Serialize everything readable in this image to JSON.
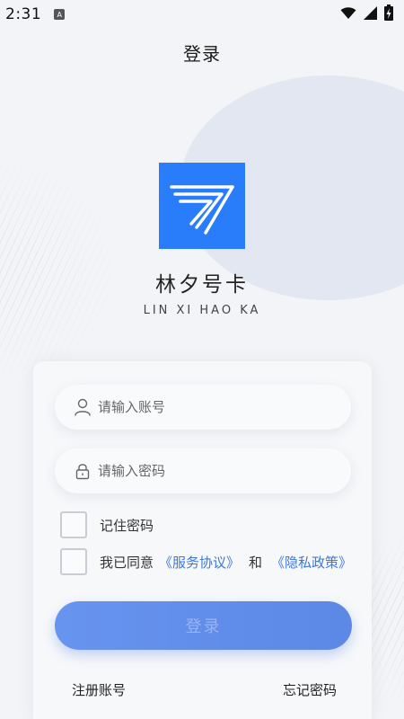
{
  "status_bar": {
    "time": "2:31",
    "app_icon_glyph": "A"
  },
  "header": {
    "title": "登录"
  },
  "brand": {
    "name": "林夕号卡",
    "subtitle": "LIN XI HAO KA",
    "logo_color": "#2a7dfa"
  },
  "form": {
    "account_placeholder": "请输入账号",
    "account_value": "",
    "password_placeholder": "请输入密码",
    "password_value": "",
    "remember_label": "记住密码",
    "agree_prefix": "我已同意",
    "service_link": "《服务协议》",
    "and_text": "和",
    "privacy_link": "《隐私政策》",
    "login_label": "登录"
  },
  "footer": {
    "register_label": "注册账号",
    "forgot_label": "忘记密码"
  },
  "colors": {
    "accent": "#5c88e6",
    "link": "#3e78d8",
    "background": "#f3f4f7"
  },
  "icons": {
    "account": "user-icon",
    "password": "lock-icon"
  }
}
